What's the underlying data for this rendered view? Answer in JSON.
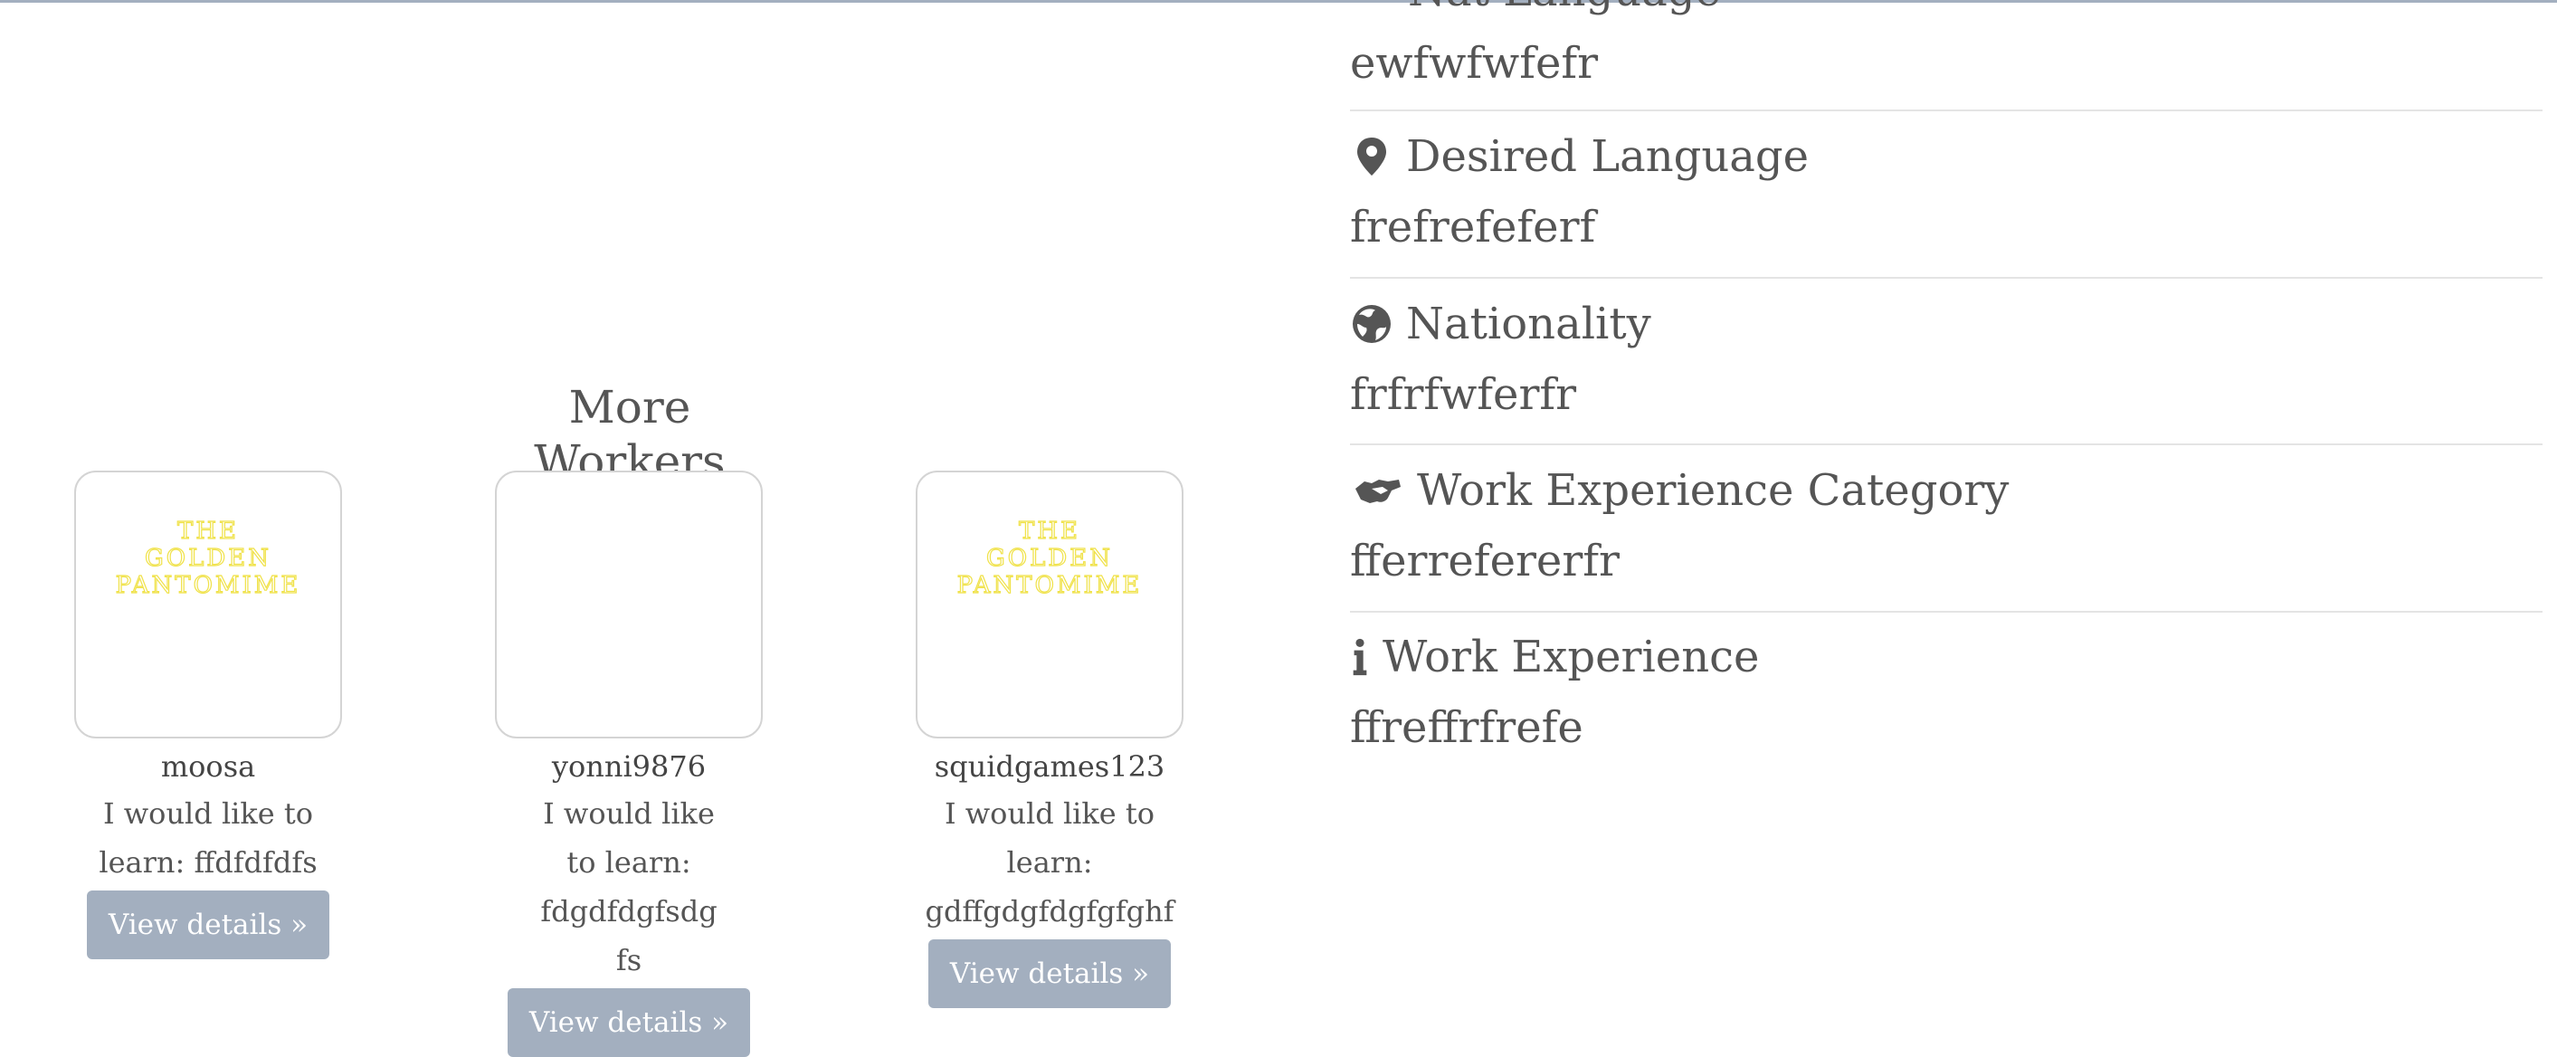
{
  "details": {
    "cut_label": "Nat Language",
    "first_value": "ewfwfwfefr",
    "desired_language": {
      "label": "Desired Language",
      "value": "frefrefeferf",
      "icon": "map-pin-icon"
    },
    "nationality": {
      "label": "Nationality",
      "value": "frfrfwferfr",
      "icon": "globe-icon"
    },
    "work_category": {
      "label": "Work Experience Category",
      "value": "fferrefererfr",
      "icon": "handshake-icon"
    },
    "work_experience": {
      "label": "Work Experience",
      "value": "ffreffrfrefe",
      "icon": "info-icon"
    }
  },
  "more_workers": {
    "title": "More Workers",
    "workers": [
      {
        "name": "moosa",
        "desc": "I would like to learn: ffdfdfdfs",
        "button": "View details »",
        "logo": "THE GOLDEN PANTOMIME"
      },
      {
        "name": "yonni9876",
        "desc": "I would like to learn: fdgdfdgfsdgfs",
        "button": "View details »",
        "logo": ""
      },
      {
        "name": "squidgames123",
        "desc": "I would like to learn: gdffgdgfdgfgfghf",
        "button": "View details »",
        "logo": "THE GOLDEN PANTOMIME"
      }
    ]
  },
  "colors": {
    "button": "#a3afbf",
    "logo": "#f0e24a",
    "text": "#555555"
  }
}
